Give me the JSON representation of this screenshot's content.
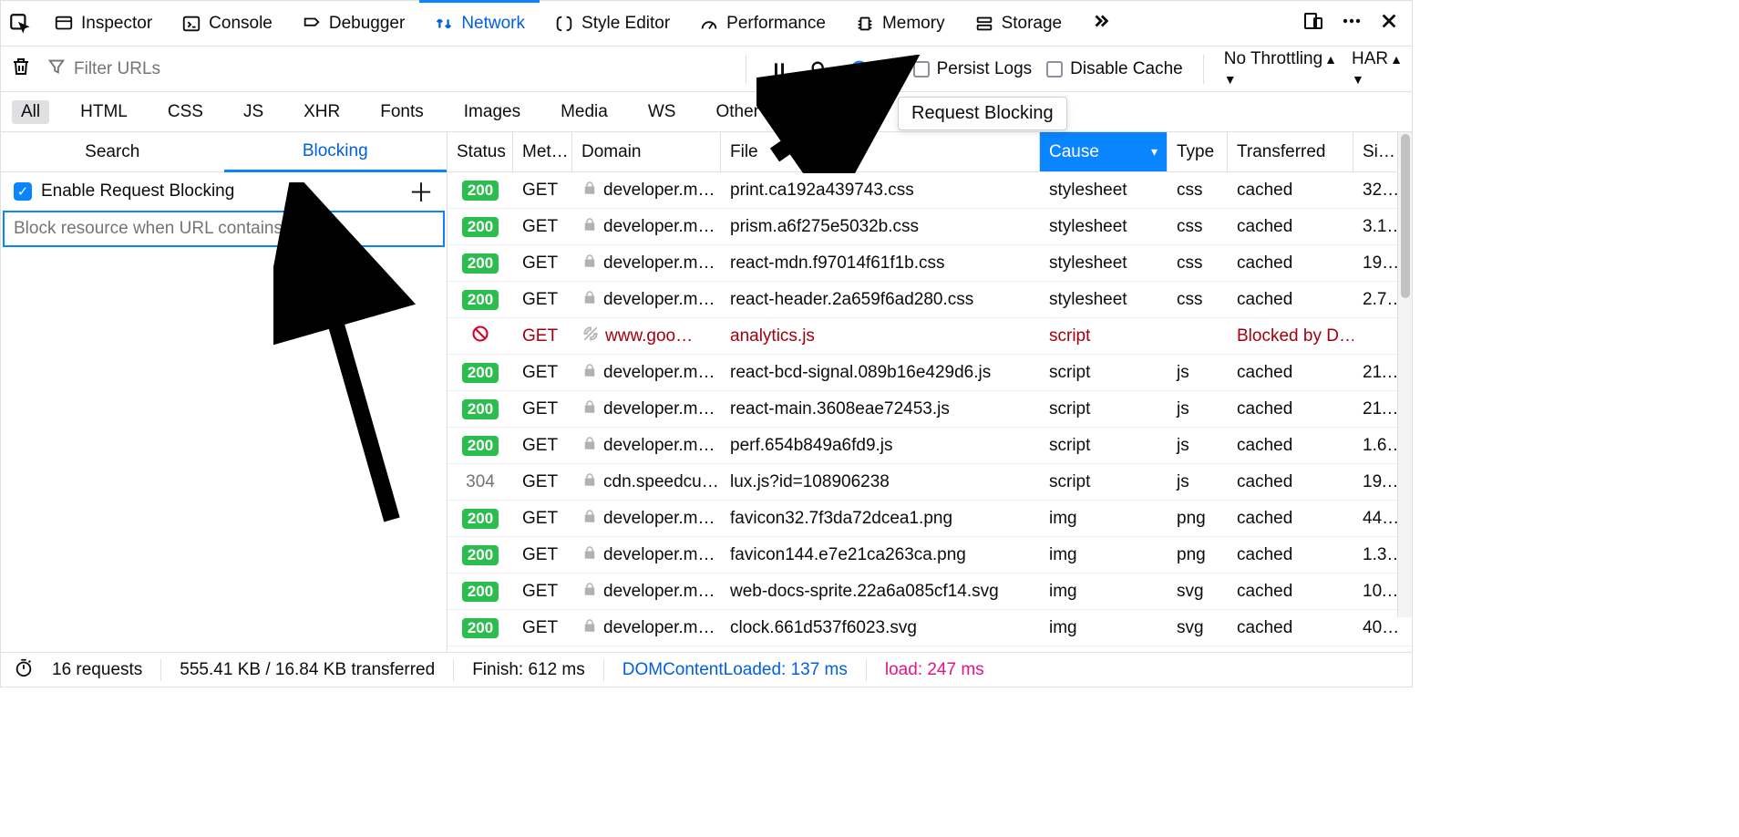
{
  "tabs": [
    {
      "key": "inspector",
      "label": "Inspector"
    },
    {
      "key": "console",
      "label": "Console"
    },
    {
      "key": "debugger",
      "label": "Debugger"
    },
    {
      "key": "network",
      "label": "Network"
    },
    {
      "key": "style",
      "label": "Style Editor"
    },
    {
      "key": "perf",
      "label": "Performance"
    },
    {
      "key": "memory",
      "label": "Memory"
    },
    {
      "key": "storage",
      "label": "Storage"
    }
  ],
  "active_tab": "network",
  "toolbar": {
    "filter_placeholder": "Filter URLs",
    "persist_label": "Persist Logs",
    "disable_cache_label": "Disable Cache",
    "throttle": "No Throttling",
    "har": "HAR"
  },
  "type_filters": [
    "All",
    "HTML",
    "CSS",
    "JS",
    "XHR",
    "Fonts",
    "Images",
    "Media",
    "WS",
    "Other"
  ],
  "active_type_filter": "All",
  "sidebar": {
    "tabs": {
      "search": "Search",
      "blocking": "Blocking"
    },
    "active": "blocking",
    "enable_label": "Enable Request Blocking",
    "enable_checked": true,
    "input_placeholder": "Block resource when URL contains"
  },
  "columns": {
    "status": "Status",
    "method": "Met…",
    "domain": "Domain",
    "file": "File",
    "cause": "Cause",
    "type": "Type",
    "transferred": "Transferred",
    "size": "Si…"
  },
  "sorted_column": "cause",
  "requests": [
    {
      "status": "200",
      "method": "GET",
      "domain": "developer.m…",
      "file": "print.ca192a439743.css",
      "cause": "stylesheet",
      "type": "css",
      "transferred": "cached",
      "size": "32…",
      "lock": true
    },
    {
      "status": "200",
      "method": "GET",
      "domain": "developer.m…",
      "file": "prism.a6f275e5032b.css",
      "cause": "stylesheet",
      "type": "css",
      "transferred": "cached",
      "size": "3.1…",
      "lock": true
    },
    {
      "status": "200",
      "method": "GET",
      "domain": "developer.m…",
      "file": "react-mdn.f97014f61f1b.css",
      "cause": "stylesheet",
      "type": "css",
      "transferred": "cached",
      "size": "19…",
      "lock": true
    },
    {
      "status": "200",
      "method": "GET",
      "domain": "developer.m…",
      "file": "react-header.2a659f6ad280.css",
      "cause": "stylesheet",
      "type": "css",
      "transferred": "cached",
      "size": "2.7…",
      "lock": true
    },
    {
      "status": "blocked",
      "method": "GET",
      "domain": "www.goo…",
      "file": "analytics.js",
      "cause": "script",
      "type": "",
      "transferred": "Blocked by D…",
      "size": "",
      "tracker": true
    },
    {
      "status": "200",
      "method": "GET",
      "domain": "developer.m…",
      "file": "react-bcd-signal.089b16e429d6.js",
      "cause": "script",
      "type": "js",
      "transferred": "cached",
      "size": "21.…",
      "lock": true
    },
    {
      "status": "200",
      "method": "GET",
      "domain": "developer.m…",
      "file": "react-main.3608eae72453.js",
      "cause": "script",
      "type": "js",
      "transferred": "cached",
      "size": "21.…",
      "lock": true
    },
    {
      "status": "200",
      "method": "GET",
      "domain": "developer.m…",
      "file": "perf.654b849a6fd9.js",
      "cause": "script",
      "type": "js",
      "transferred": "cached",
      "size": "1.6…",
      "lock": true
    },
    {
      "status": "304",
      "method": "GET",
      "domain": "cdn.speedcu…",
      "file": "lux.js?id=108906238",
      "cause": "script",
      "type": "js",
      "transferred": "cached",
      "size": "19.…",
      "lock": true,
      "plain_status": true
    },
    {
      "status": "200",
      "method": "GET",
      "domain": "developer.m…",
      "file": "favicon32.7f3da72dcea1.png",
      "cause": "img",
      "type": "png",
      "transferred": "cached",
      "size": "44…",
      "lock": true
    },
    {
      "status": "200",
      "method": "GET",
      "domain": "developer.m…",
      "file": "favicon144.e7e21ca263ca.png",
      "cause": "img",
      "type": "png",
      "transferred": "cached",
      "size": "1.3…",
      "lock": true
    },
    {
      "status": "200",
      "method": "GET",
      "domain": "developer.m…",
      "file": "web-docs-sprite.22a6a085cf14.svg",
      "cause": "img",
      "type": "svg",
      "transferred": "cached",
      "size": "10.…",
      "lock": true
    },
    {
      "status": "200",
      "method": "GET",
      "domain": "developer.m…",
      "file": "clock.661d537f6023.svg",
      "cause": "img",
      "type": "svg",
      "transferred": "cached",
      "size": "40…",
      "lock": true
    }
  ],
  "summary": {
    "requests": "16 requests",
    "transferred": "555.41 KB / 16.84 KB transferred",
    "finish": "Finish: 612 ms",
    "dcl": "DOMContentLoaded: 137 ms",
    "load": "load: 247 ms"
  },
  "tooltip": "Request Blocking"
}
